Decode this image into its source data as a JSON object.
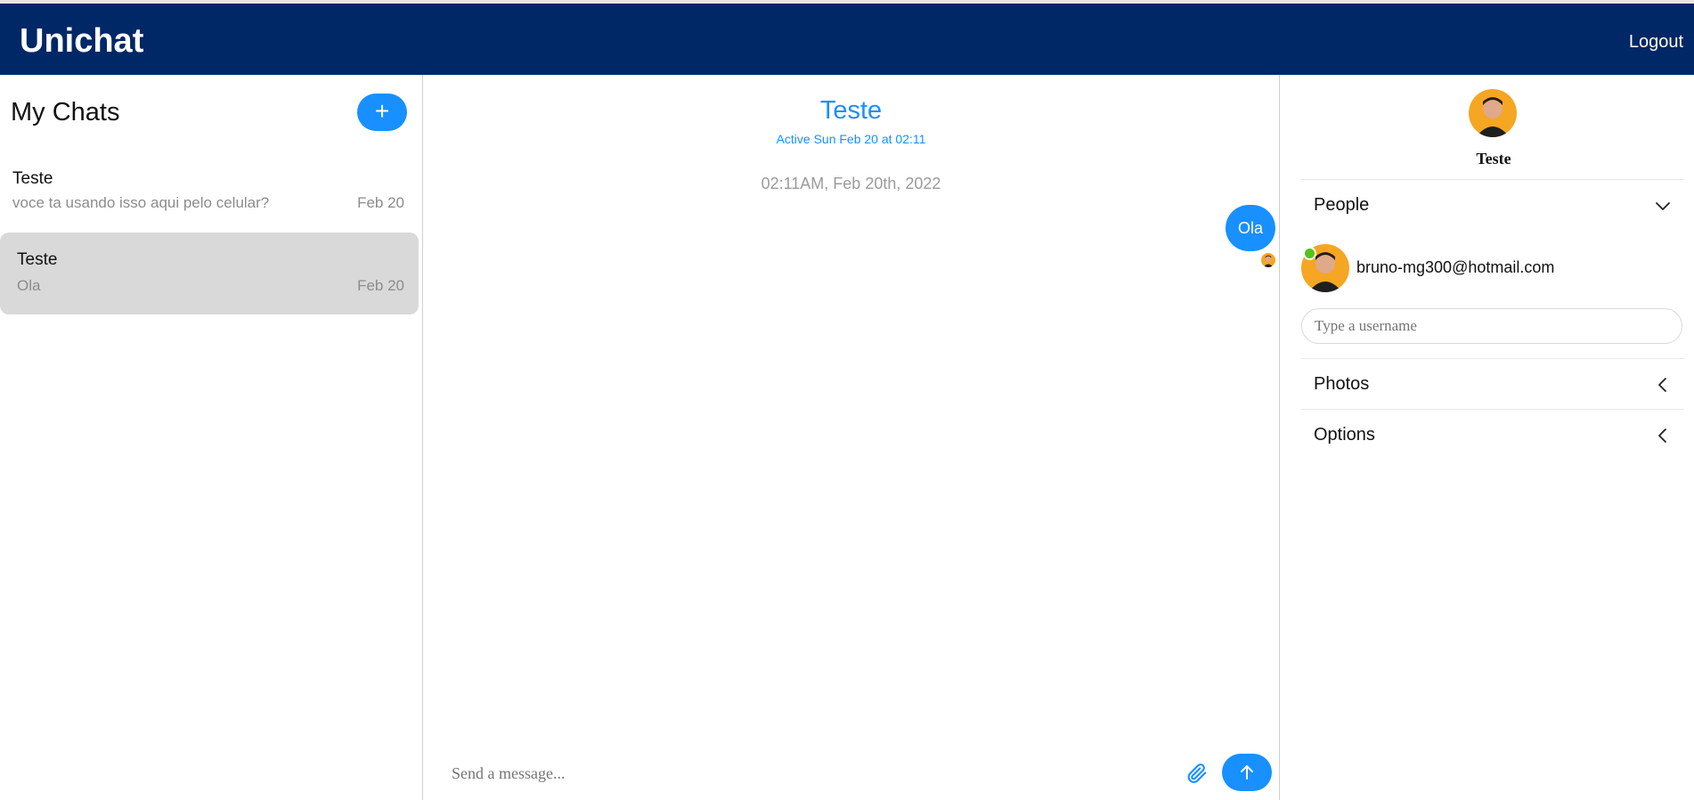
{
  "header": {
    "brand": "Unichat",
    "logout_label": "Logout"
  },
  "sidebar": {
    "title": "My Chats",
    "new_chat_label": "+",
    "chats": [
      {
        "name": "Teste",
        "preview": "voce ta usando isso aqui pelo celular?",
        "date": "Feb 20",
        "active": false
      },
      {
        "name": "Teste",
        "preview": "Ola",
        "date": "Feb 20",
        "active": true
      }
    ]
  },
  "conversation": {
    "title": "Teste",
    "subtitle": "Active Sun Feb 20 at 02:11",
    "timestamp": "02:11AM, Feb 20th, 2022",
    "messages": [
      {
        "text": "Ola",
        "own": true
      }
    ],
    "composer_placeholder": "Send a message..."
  },
  "details": {
    "name": "Teste",
    "sections": [
      {
        "label": "People",
        "expanded": true,
        "icon": "chevron-down-icon"
      },
      {
        "label": "Photos",
        "expanded": false,
        "icon": "chevron-left-icon"
      },
      {
        "label": "Options",
        "expanded": false,
        "icon": "chevron-left-icon"
      }
    ],
    "people": [
      {
        "email": "bruno-mg300@hotmail.com",
        "online": true
      }
    ],
    "username_placeholder": "Type a username"
  },
  "colors": {
    "navbar": "#002766",
    "accent": "#1890ff",
    "active_chat": "#d9d9d9",
    "online": "#52c41a",
    "avatar_bg": "#f5a623"
  }
}
